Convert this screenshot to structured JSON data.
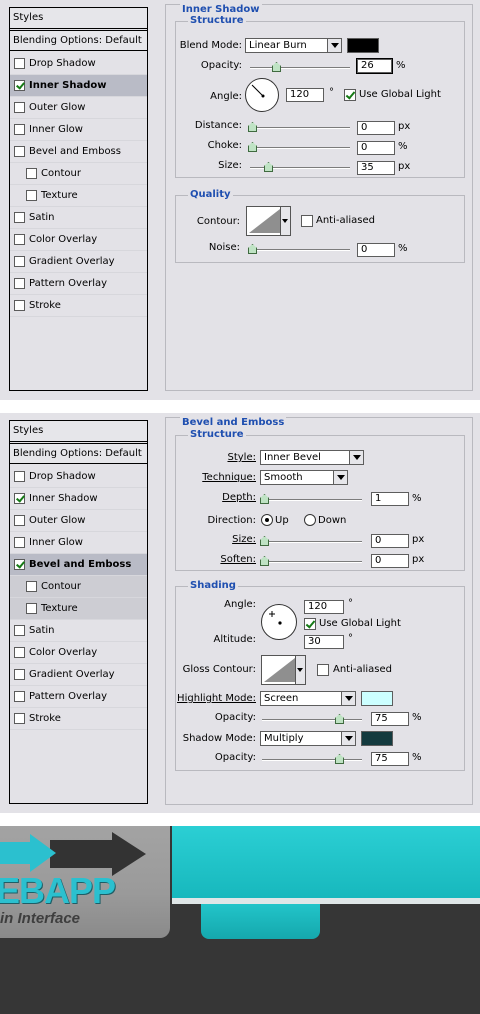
{
  "panel1": {
    "styles_header": "Styles",
    "blending_header": "Blending Options: Default",
    "items": [
      {
        "label": "Drop Shadow",
        "checked": false,
        "sub": false,
        "active": false
      },
      {
        "label": "Inner Shadow",
        "checked": true,
        "sub": false,
        "active": true
      },
      {
        "label": "Outer Glow",
        "checked": false,
        "sub": false,
        "active": false
      },
      {
        "label": "Inner Glow",
        "checked": false,
        "sub": false,
        "active": false
      },
      {
        "label": "Bevel and Emboss",
        "checked": false,
        "sub": false,
        "active": false
      },
      {
        "label": "Contour",
        "checked": false,
        "sub": true,
        "active": false
      },
      {
        "label": "Texture",
        "checked": false,
        "sub": true,
        "active": false
      },
      {
        "label": "Satin",
        "checked": false,
        "sub": false,
        "active": false
      },
      {
        "label": "Color Overlay",
        "checked": false,
        "sub": false,
        "active": false
      },
      {
        "label": "Gradient Overlay",
        "checked": false,
        "sub": false,
        "active": false
      },
      {
        "label": "Pattern Overlay",
        "checked": false,
        "sub": false,
        "active": false
      },
      {
        "label": "Stroke",
        "checked": false,
        "sub": false,
        "active": false
      }
    ],
    "section_title": "Inner Shadow",
    "structure_title": "Structure",
    "blend_mode_label": "Blend Mode:",
    "blend_mode_value": "Linear Burn",
    "blend_color": "#000000",
    "opacity_label": "Opacity:",
    "opacity_value": "26",
    "angle_label": "Angle:",
    "angle_value": "120",
    "degree": "°",
    "use_global_light": "Use Global Light",
    "distance_label": "Distance:",
    "distance_value": "0",
    "choke_label": "Choke:",
    "choke_value": "0",
    "size_label": "Size:",
    "size_value": "35",
    "quality_title": "Quality",
    "contour_label": "Contour:",
    "anti_aliased": "Anti-aliased",
    "noise_label": "Noise:",
    "noise_value": "0",
    "pct": "%",
    "px": "px"
  },
  "panel2": {
    "styles_header": "Styles",
    "blending_header": "Blending Options: Default",
    "items": [
      {
        "label": "Drop Shadow",
        "checked": false,
        "sub": false,
        "active": false
      },
      {
        "label": "Inner Shadow",
        "checked": true,
        "sub": false,
        "active": false
      },
      {
        "label": "Outer Glow",
        "checked": false,
        "sub": false,
        "active": false
      },
      {
        "label": "Inner Glow",
        "checked": false,
        "sub": false,
        "active": false
      },
      {
        "label": "Bevel and Emboss",
        "checked": true,
        "sub": false,
        "active": true
      },
      {
        "label": "Contour",
        "checked": false,
        "sub": true,
        "active": false
      },
      {
        "label": "Texture",
        "checked": false,
        "sub": true,
        "active": false
      },
      {
        "label": "Satin",
        "checked": false,
        "sub": false,
        "active": false
      },
      {
        "label": "Color Overlay",
        "checked": false,
        "sub": false,
        "active": false
      },
      {
        "label": "Gradient Overlay",
        "checked": false,
        "sub": false,
        "active": false
      },
      {
        "label": "Pattern Overlay",
        "checked": false,
        "sub": false,
        "active": false
      },
      {
        "label": "Stroke",
        "checked": false,
        "sub": false,
        "active": false
      }
    ],
    "section_title": "Bevel and Emboss",
    "structure_title": "Structure",
    "style_label": "Style:",
    "style_value": "Inner Bevel",
    "technique_label": "Technique:",
    "technique_value": "Smooth",
    "depth_label": "Depth:",
    "depth_value": "1",
    "direction_label": "Direction:",
    "dir_up": "Up",
    "dir_down": "Down",
    "size_label": "Size:",
    "size_value": "0",
    "soften_label": "Soften:",
    "soften_value": "0",
    "shading_title": "Shading",
    "angle_label": "Angle:",
    "angle_value": "120",
    "degree": "°",
    "use_global_light": "Use Global Light",
    "altitude_label": "Altitude:",
    "altitude_value": "30",
    "gloss_label": "Gloss Contour:",
    "anti_aliased": "Anti-aliased",
    "highlight_label": "Highlight Mode:",
    "highlight_value": "Screen",
    "highlight_color": "#ccffff",
    "hl_opacity_label": "Opacity:",
    "hl_opacity_value": "75",
    "shadow_label": "Shadow Mode:",
    "shadow_value": "Multiply",
    "shadow_color": "#133a3e",
    "sh_opacity_label": "Opacity:",
    "sh_opacity_value": "75",
    "pct": "%",
    "px": "px"
  },
  "banner": {
    "logo_text": "EBAPP",
    "logo_sub": "in Interface",
    "accent": "#2bcfd4"
  }
}
